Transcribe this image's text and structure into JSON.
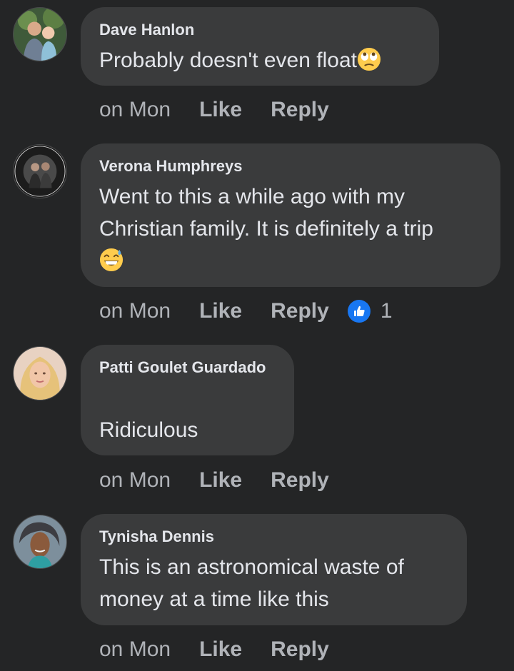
{
  "comments": [
    {
      "author": "Dave Hanlon",
      "text": "Probably doesn't even float",
      "emoji": "face-with-rolling-eyes",
      "time": "on Mon",
      "like_label": "Like",
      "reply_label": "Reply"
    },
    {
      "author": "Verona Humphreys",
      "text_line1": "Went to this a while ago with my",
      "text_line2": "Christian family. It is definitely a trip",
      "emoji": "grinning-face-with-sweat",
      "time": "on Mon",
      "like_label": "Like",
      "reply_label": "Reply",
      "reaction_count": "1",
      "reaction_type": "like"
    },
    {
      "author": "Patti Goulet Guardado",
      "text": "Ridiculous",
      "time": "on Mon",
      "like_label": "Like",
      "reply_label": "Reply"
    },
    {
      "author": "Tynisha Dennis",
      "text_line1": "This is an astronomical waste of",
      "text_line2": "money at a time like this",
      "time": "on Mon",
      "like_label": "Like",
      "reply_label": "Reply"
    }
  ],
  "colors": {
    "background": "#242526",
    "bubble": "#3a3b3c",
    "text": "#e4e6eb",
    "secondary_text": "#b0b3b8",
    "like_blue": "#1877f2"
  }
}
